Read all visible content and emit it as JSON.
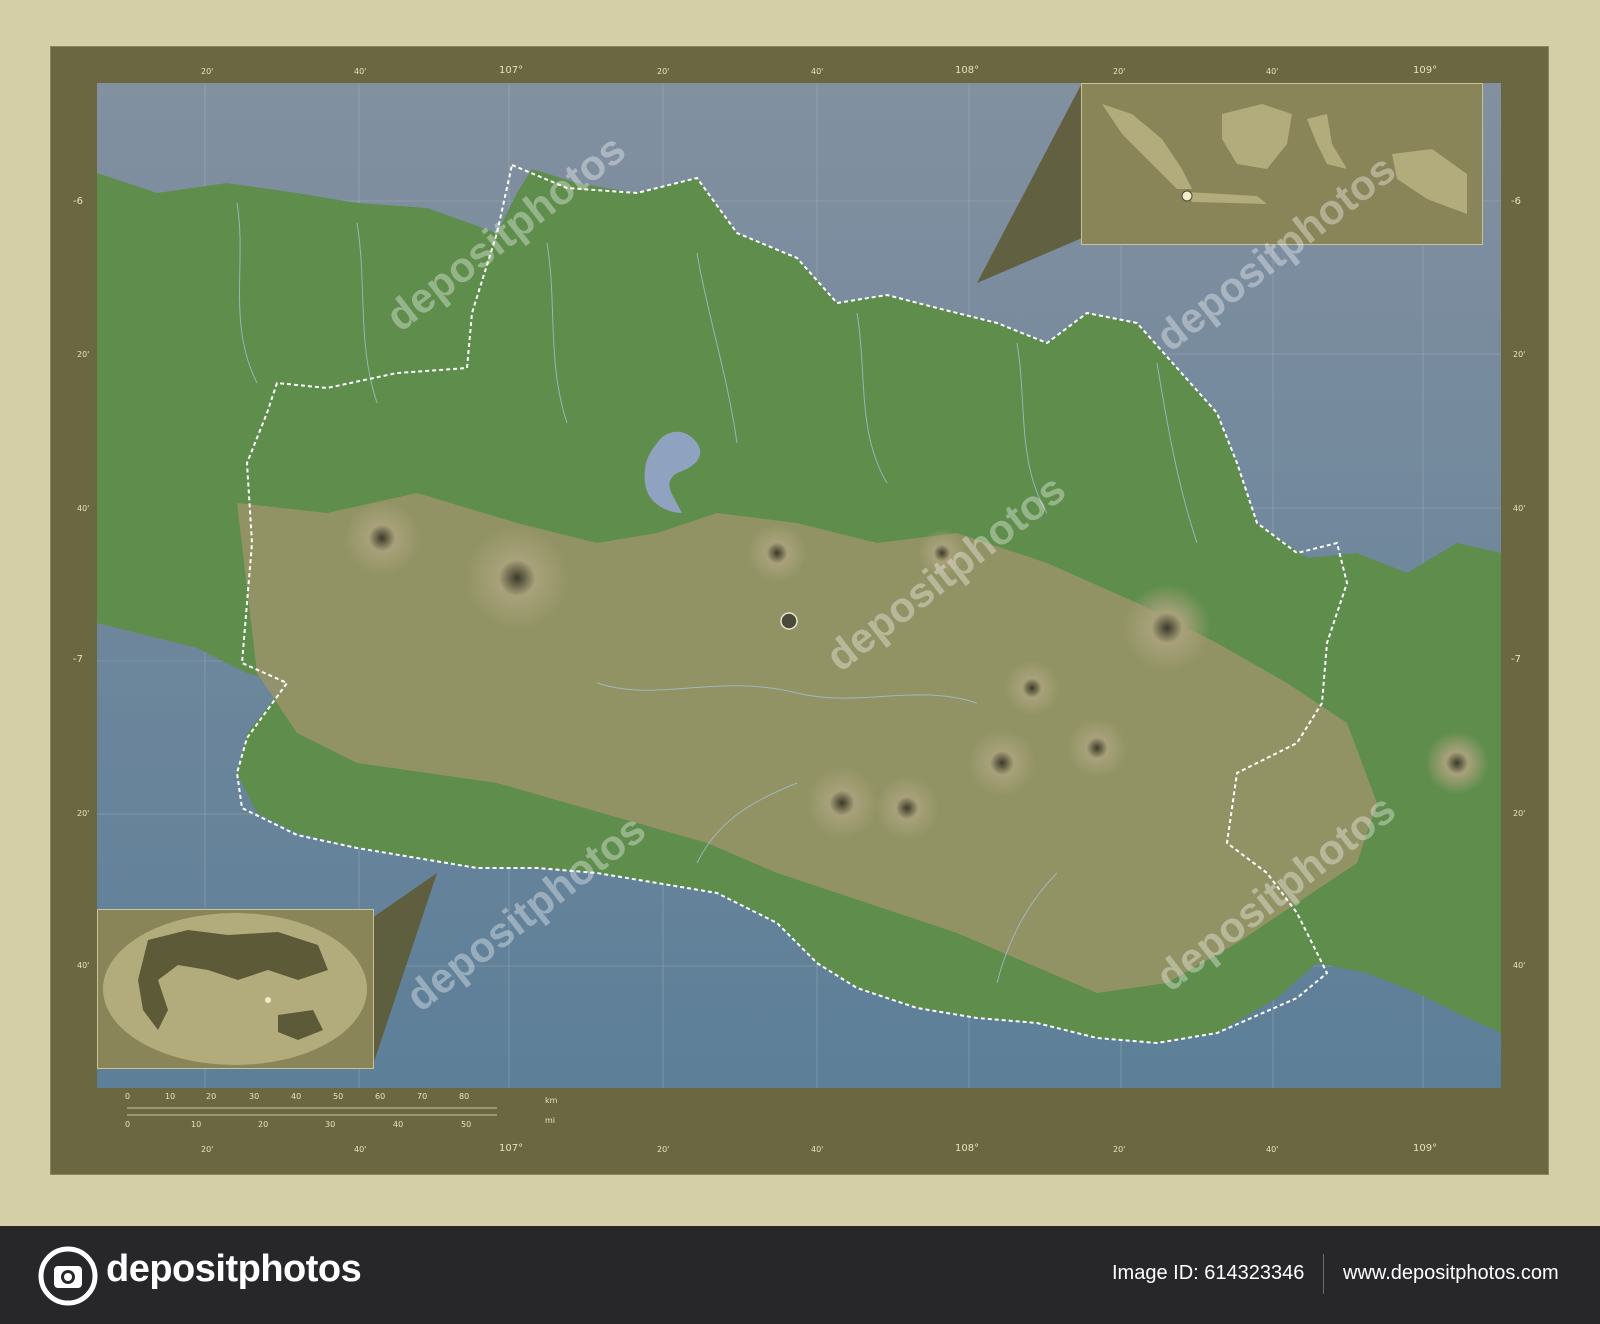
{
  "map": {
    "lon_ticks_top": [
      "20'",
      "40'",
      "107°",
      "20'",
      "40'",
      "108°",
      "20'",
      "40'",
      "109°"
    ],
    "lon_ticks_bottom": [
      "20'",
      "40'",
      "107°",
      "20'",
      "40'",
      "108°",
      "20'",
      "40'",
      "109°"
    ],
    "lat_ticks_left": [
      "-6",
      "20'",
      "40'",
      "-7",
      "20'",
      "40'"
    ],
    "lat_ticks_right": [
      "-6",
      "20'",
      "40'",
      "-7",
      "20'",
      "40'"
    ],
    "colors": {
      "sea": "#7d8a98",
      "lowland": "#5a8a4a",
      "highland": "#9b9468",
      "boundary": "#ffffff",
      "frame": "#6b6841",
      "inset": "#8a8558"
    }
  },
  "scale": {
    "km_unit": "km",
    "mi_unit": "mi",
    "km_ticks": [
      "0",
      "10",
      "20",
      "30",
      "40",
      "50",
      "60",
      "70",
      "80"
    ],
    "mi_ticks": [
      "0",
      "10",
      "20",
      "30",
      "40",
      "50"
    ]
  },
  "watermark": {
    "text": "depositphotos"
  },
  "footer": {
    "logo_text": "depositphotos",
    "image_id": "Image ID: 614323346",
    "site": "www.depositphotos.com"
  }
}
